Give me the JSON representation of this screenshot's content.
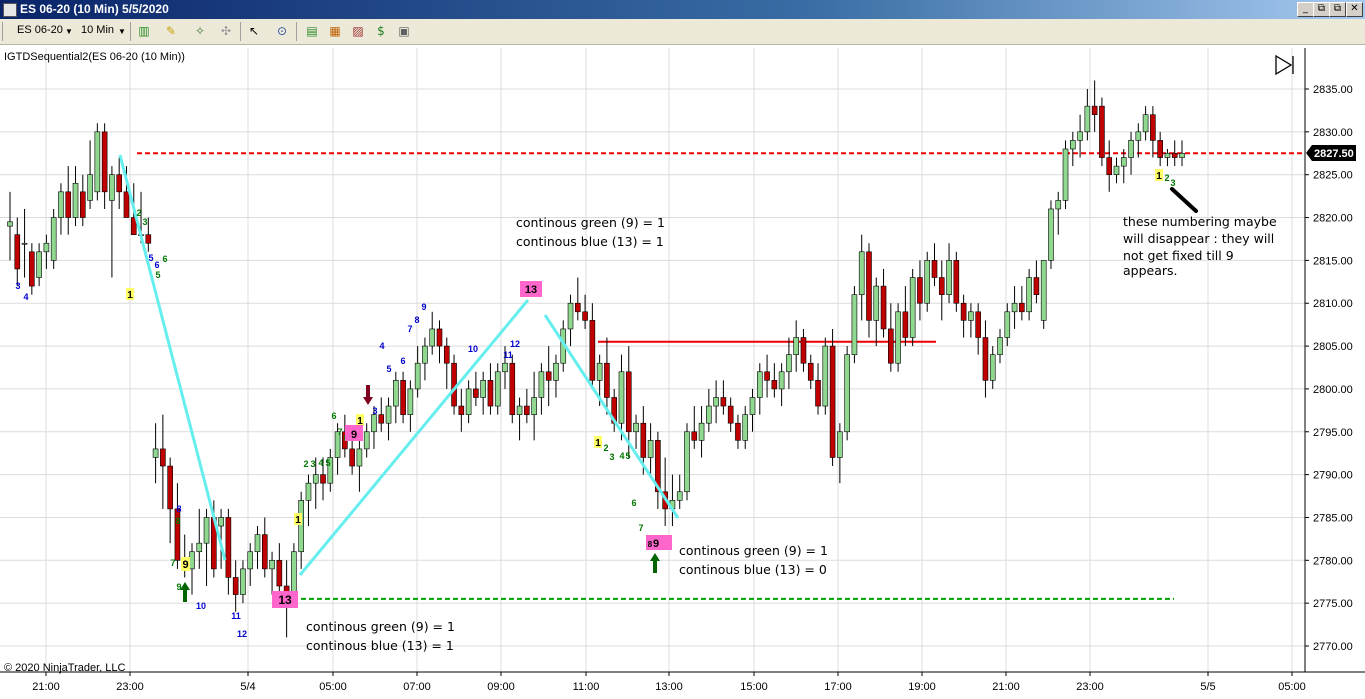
{
  "window": {
    "title": "ES 06-20 (10 Min)  5/5/2020",
    "buttons": [
      "_",
      "□",
      "✕"
    ],
    "inner_buttons": [
      "_",
      "⧉",
      "✕"
    ]
  },
  "toolbar": {
    "instrument": "ES 06-20",
    "interval": "10 Min"
  },
  "indicator_label": "IGTDSequential2(ES 06-20 (10 Min))",
  "copyright": "© 2020 NinjaTrader, LLC",
  "price_tag": "2827.50",
  "y_ticks": [
    "2835.00",
    "2830.00",
    "2825.00",
    "2820.00",
    "2815.00",
    "2810.00",
    "2805.00",
    "2800.00",
    "2795.00",
    "2790.00",
    "2785.00",
    "2780.00",
    "2775.00",
    "2770.00"
  ],
  "x_ticks": [
    "21:00",
    "23:00",
    "5/4",
    "05:00",
    "07:00",
    "09:00",
    "11:00",
    "13:00",
    "15:00",
    "17:00",
    "19:00",
    "21:00",
    "23:00",
    "5/5",
    "05:00"
  ],
  "annotations": {
    "a1": [
      "continous green (9) = 1",
      "continous blue (13) = 1"
    ],
    "a2": [
      "continous green (9) = 1",
      "continous blue (13) = 0"
    ],
    "a3": [
      "continous green (9) = 1",
      "continous blue (13) = 1"
    ],
    "a4": [
      "these numbering maybe",
      "will disappear : they will",
      "not get fixed till 9",
      "appears."
    ]
  },
  "colors": {
    "up": "#90d890",
    "down": "#c00000",
    "trend": "#66eeee",
    "red_line": "#ee0000",
    "green_line": "#00a000",
    "blue_num": "#0000cc",
    "green_num": "#007700",
    "yellow_box": "#ffff66",
    "pink_box": "#ff66cc"
  },
  "chart_data": {
    "type": "candlestick",
    "ylim": [
      2768,
      2838
    ],
    "levels": {
      "red_dashed": 2827.5,
      "red_solid": 2805.5,
      "green_dashed": 2775.5
    },
    "candles": [
      [
        2819,
        2823,
        2815,
        2819.5
      ],
      [
        2818,
        2820,
        2812,
        2814
      ],
      [
        2817,
        2821,
        2813,
        2817
      ],
      [
        2816,
        2817,
        2811,
        2812
      ],
      [
        2813,
        2817,
        2812,
        2816
      ],
      [
        2816,
        2818,
        2814,
        2817
      ],
      [
        2815,
        2821,
        2814,
        2820
      ],
      [
        2820,
        2824,
        2818,
        2823
      ],
      [
        2823,
        2826,
        2818,
        2820
      ],
      [
        2820,
        2826,
        2819,
        2824
      ],
      [
        2823,
        2825,
        2819,
        2820
      ],
      [
        2822,
        2829,
        2821,
        2825
      ],
      [
        2823,
        2831,
        2822,
        2830
      ],
      [
        2830,
        2831,
        2821,
        2823
      ],
      [
        2822,
        2826,
        2813,
        2825
      ],
      [
        2825,
        2827,
        2821,
        2823
      ],
      [
        2823,
        2826,
        2820,
        2820
      ],
      [
        2820,
        2824,
        2818,
        2818
      ],
      [
        2818,
        2823,
        2817,
        2818
      ],
      [
        2818,
        2820,
        2816,
        2817
      ],
      [
        2792,
        2796,
        2789,
        2793
      ],
      [
        2793,
        2797,
        2786,
        2791
      ],
      [
        2791,
        2792,
        2782,
        2786
      ],
      [
        2786,
        2789,
        2779,
        2780
      ],
      [
        2780,
        2783,
        2778,
        2779
      ],
      [
        2779,
        2782,
        2776,
        2781
      ],
      [
        2781,
        2786,
        2779,
        2782
      ],
      [
        2782,
        2786,
        2777,
        2785
      ],
      [
        2785,
        2787,
        2778,
        2779
      ],
      [
        2784,
        2786,
        2779,
        2785
      ],
      [
        2785,
        2786,
        2776,
        2778
      ],
      [
        2778,
        2780,
        2774,
        2776
      ],
      [
        2776,
        2780,
        2775,
        2779
      ],
      [
        2779,
        2782,
        2777,
        2781
      ],
      [
        2781,
        2784,
        2779,
        2783
      ],
      [
        2783,
        2785,
        2778,
        2779
      ],
      [
        2779,
        2781,
        2776,
        2780
      ],
      [
        2780,
        2782,
        2776,
        2777
      ],
      [
        2777,
        2780,
        2771,
        2776
      ],
      [
        2776,
        2782,
        2775,
        2781
      ],
      [
        2781,
        2788,
        2779,
        2787
      ],
      [
        2787,
        2790,
        2784,
        2789
      ],
      [
        2789,
        2792,
        2786,
        2790
      ],
      [
        2790,
        2792,
        2787,
        2789
      ],
      [
        2789,
        2793,
        2788,
        2792
      ],
      [
        2792,
        2796,
        2790,
        2795
      ],
      [
        2795,
        2797,
        2792,
        2793
      ],
      [
        2793,
        2795,
        2790,
        2791
      ],
      [
        2791,
        2794,
        2788,
        2793
      ],
      [
        2793,
        2796,
        2792,
        2795
      ],
      [
        2795,
        2798,
        2793,
        2797
      ],
      [
        2797,
        2799,
        2795,
        2796
      ],
      [
        2796,
        2799,
        2794,
        2798
      ],
      [
        2798,
        2802,
        2796,
        2801
      ],
      [
        2801,
        2802,
        2796,
        2797
      ],
      [
        2797,
        2801,
        2795,
        2800
      ],
      [
        2800,
        2805,
        2799,
        2803
      ],
      [
        2803,
        2806,
        2801,
        2805
      ],
      [
        2805,
        2809,
        2804,
        2807
      ],
      [
        2807,
        2808,
        2803,
        2805
      ],
      [
        2805,
        2806,
        2800,
        2803
      ],
      [
        2803,
        2804,
        2797,
        2798
      ],
      [
        2798,
        2800,
        2795,
        2797
      ],
      [
        2797,
        2801,
        2796,
        2800
      ],
      [
        2800,
        2802,
        2798,
        2799
      ],
      [
        2799,
        2802,
        2797,
        2801
      ],
      [
        2801,
        2803,
        2797,
        2798
      ],
      [
        2798,
        2803,
        2797,
        2802
      ],
      [
        2802,
        2805,
        2800,
        2803
      ],
      [
        2803,
        2804,
        2796,
        2797
      ],
      [
        2797,
        2799,
        2794,
        2798
      ],
      [
        2798,
        2800,
        2796,
        2797
      ],
      [
        2797,
        2802,
        2794,
        2799
      ],
      [
        2799,
        2803,
        2797,
        2802
      ],
      [
        2802,
        2805,
        2798,
        2801
      ],
      [
        2801,
        2804,
        2799,
        2803
      ],
      [
        2803,
        2808,
        2802,
        2807
      ],
      [
        2807,
        2811,
        2805,
        2810
      ],
      [
        2810,
        2813,
        2808,
        2809
      ],
      [
        2809,
        2811,
        2807,
        2808
      ],
      [
        2808,
        2810,
        2800,
        2801
      ],
      [
        2801,
        2804,
        2798,
        2803
      ],
      [
        2803,
        2806,
        2797,
        2799
      ],
      [
        2799,
        2800,
        2795,
        2796
      ],
      [
        2796,
        2804,
        2794,
        2802
      ],
      [
        2802,
        2805,
        2792,
        2795
      ],
      [
        2795,
        2797,
        2793,
        2796
      ],
      [
        2796,
        2798,
        2790,
        2792
      ],
      [
        2792,
        2796,
        2790,
        2794
      ],
      [
        2794,
        2795,
        2786,
        2788
      ],
      [
        2788,
        2792,
        2784,
        2786
      ],
      [
        2786,
        2790,
        2784,
        2787
      ],
      [
        2787,
        2790,
        2786,
        2788
      ],
      [
        2788,
        2796,
        2787,
        2795
      ],
      [
        2795,
        2798,
        2793,
        2794
      ],
      [
        2794,
        2798,
        2792,
        2796
      ],
      [
        2796,
        2800,
        2795,
        2798
      ],
      [
        2798,
        2801,
        2796,
        2799
      ],
      [
        2799,
        2801,
        2797,
        2798
      ],
      [
        2798,
        2799,
        2795,
        2796
      ],
      [
        2796,
        2797,
        2793,
        2794
      ],
      [
        2794,
        2798,
        2793,
        2797
      ],
      [
        2797,
        2800,
        2795,
        2799
      ],
      [
        2799,
        2803,
        2797,
        2802
      ],
      [
        2802,
        2804,
        2799,
        2801
      ],
      [
        2801,
        2803,
        2799,
        2800
      ],
      [
        2800,
        2803,
        2798,
        2802
      ],
      [
        2802,
        2806,
        2800,
        2804
      ],
      [
        2804,
        2808,
        2802,
        2806
      ],
      [
        2806,
        2807,
        2802,
        2803
      ],
      [
        2803,
        2804,
        2800,
        2801
      ],
      [
        2801,
        2803,
        2797,
        2798
      ],
      [
        2798,
        2806,
        2797,
        2805
      ],
      [
        2805,
        2807,
        2791,
        2792
      ],
      [
        2792,
        2796,
        2789,
        2795
      ],
      [
        2795,
        2805,
        2794,
        2804
      ],
      [
        2804,
        2812,
        2803,
        2811
      ],
      [
        2811,
        2818,
        2808,
        2816
      ],
      [
        2816,
        2817,
        2806,
        2808
      ],
      [
        2808,
        2813,
        2805,
        2812
      ],
      [
        2812,
        2814,
        2806,
        2807
      ],
      [
        2807,
        2810,
        2802,
        2803
      ],
      [
        2803,
        2810,
        2802,
        2809
      ],
      [
        2809,
        2812,
        2805,
        2806
      ],
      [
        2806,
        2814,
        2805,
        2813
      ],
      [
        2813,
        2815,
        2808,
        2810
      ],
      [
        2810,
        2816,
        2809,
        2815
      ],
      [
        2815,
        2817,
        2812,
        2813
      ],
      [
        2813,
        2815,
        2808,
        2811
      ],
      [
        2811,
        2817,
        2810,
        2815
      ],
      [
        2815,
        2816,
        2809,
        2810
      ],
      [
        2810,
        2811,
        2806,
        2808
      ],
      [
        2808,
        2810,
        2806,
        2809
      ],
      [
        2809,
        2810,
        2804,
        2806
      ],
      [
        2806,
        2808,
        2799,
        2801
      ],
      [
        2801,
        2805,
        2800,
        2804
      ],
      [
        2804,
        2807,
        2803,
        2806
      ],
      [
        2806,
        2810,
        2805,
        2809
      ],
      [
        2809,
        2812,
        2807,
        2810
      ],
      [
        2810,
        2812,
        2808,
        2809
      ],
      [
        2809,
        2814,
        2808,
        2813
      ],
      [
        2813,
        2815,
        2810,
        2811
      ],
      [
        2808,
        2815,
        2807,
        2815
      ],
      [
        2815,
        2822,
        2814,
        2821
      ],
      [
        2821,
        2823,
        2818,
        2822
      ],
      [
        2822,
        2829,
        2821,
        2828
      ],
      [
        2828,
        2830,
        2826,
        2829
      ],
      [
        2829,
        2832,
        2827,
        2830
      ],
      [
        2830,
        2835,
        2829,
        2833
      ],
      [
        2833,
        2836,
        2830,
        2832
      ],
      [
        2833,
        2834,
        2826,
        2827
      ],
      [
        2827,
        2829,
        2823,
        2825
      ],
      [
        2825,
        2827,
        2824,
        2826
      ],
      [
        2826,
        2828,
        2824,
        2827
      ],
      [
        2827,
        2830,
        2825,
        2829
      ],
      [
        2829,
        2831,
        2827,
        2830
      ],
      [
        2830,
        2833,
        2829,
        2832
      ],
      [
        2832,
        2833,
        2827,
        2829
      ],
      [
        2829,
        2830,
        2826,
        2827
      ],
      [
        2827,
        2828,
        2826,
        2827.5
      ],
      [
        2827.5,
        2829,
        2826,
        2827
      ],
      [
        2827,
        2829,
        2826,
        2827.5
      ]
    ]
  }
}
